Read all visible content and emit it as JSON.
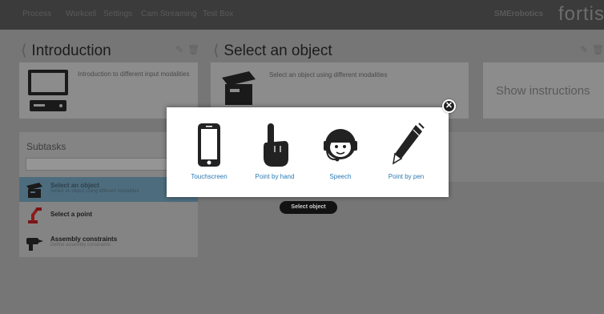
{
  "nav": {
    "items": [
      "Process",
      "Workcell",
      "Settings",
      "Cam Streaming",
      "Test Box"
    ]
  },
  "brand": {
    "small": "SMErobotics",
    "logo": "fortiss"
  },
  "left_panel": {
    "title": "Introduction",
    "card_text": "Introduction to different input modalities"
  },
  "middle_panel": {
    "title": "Select an object",
    "card_text": "Select an object using different modalities"
  },
  "instructions": {
    "label": "Show instructions"
  },
  "subtasks": {
    "title": "Subtasks",
    "items": [
      {
        "name": "Select an object",
        "desc": "Select an object using different modalities",
        "icon": "box-icon"
      },
      {
        "name": "Select a point",
        "desc": "",
        "icon": "robot-arm-icon"
      },
      {
        "name": "Assembly constraints",
        "desc": "Define assembly constraints",
        "icon": "drill-icon"
      }
    ]
  },
  "action_button": {
    "label": "Select object"
  },
  "modal": {
    "options": [
      {
        "label": "Touchscreen",
        "icon": "smartphone-icon"
      },
      {
        "label": "Point by hand",
        "icon": "pointing-hand-icon"
      },
      {
        "label": "Speech",
        "icon": "headset-person-icon"
      },
      {
        "label": "Point by pen",
        "icon": "pen-icon"
      }
    ],
    "link_color": "#2a7ab3"
  }
}
